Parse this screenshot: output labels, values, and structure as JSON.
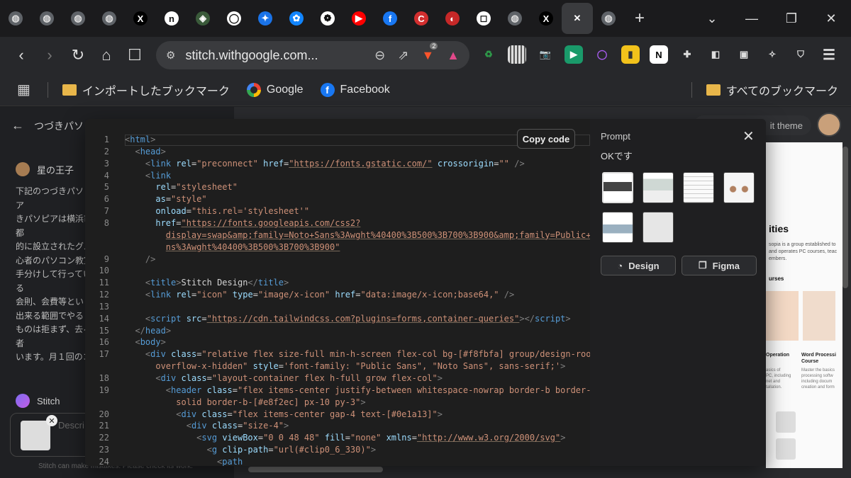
{
  "browser": {
    "tabs": [
      {
        "icon": "globe-icon",
        "color": "#9aa0a6",
        "glyph": "◍"
      },
      {
        "icon": "globe-icon",
        "color": "#9aa0a6",
        "glyph": "◍"
      },
      {
        "icon": "settings-globe-icon",
        "color": "#9aa0a6",
        "glyph": "◍"
      },
      {
        "icon": "settings-globe-icon",
        "color": "#9aa0a6",
        "glyph": "◍"
      },
      {
        "icon": "x-logo-icon",
        "color": "#000000",
        "glyph": "X"
      },
      {
        "icon": "n-logo-icon",
        "color": "#ffffff",
        "glyph": "n"
      },
      {
        "icon": "emblem-icon",
        "color": "#3a5a3a",
        "glyph": "◈"
      },
      {
        "icon": "circle-logo-icon",
        "color": "#ffffff",
        "glyph": "◯"
      },
      {
        "icon": "sparkle-icon",
        "color": "#1a73e8",
        "glyph": "✦"
      },
      {
        "icon": "butterfly-icon",
        "color": "#1185fe",
        "glyph": "✿"
      },
      {
        "icon": "openai-icon",
        "color": "#ffffff",
        "glyph": "❁"
      },
      {
        "icon": "youtube-icon",
        "color": "#ff0000",
        "glyph": "▶"
      },
      {
        "icon": "facebook-icon",
        "color": "#1877f2",
        "glyph": "f"
      },
      {
        "icon": "c-logo-icon",
        "color": "#d32f2f",
        "glyph": "C"
      },
      {
        "icon": "circle-d-icon",
        "color": "#c62828",
        "glyph": "◐"
      },
      {
        "icon": "square-logo-icon",
        "color": "#ffffff",
        "glyph": "◻"
      },
      {
        "icon": "globe-icon",
        "color": "#9aa0a6",
        "glyph": "◍"
      },
      {
        "icon": "x-logo-icon",
        "color": "#000000",
        "glyph": "X"
      },
      {
        "icon": "close-icon",
        "color": "#ffffff",
        "glyph": "✕"
      },
      {
        "icon": "globe-icon",
        "color": "#9aa0a6",
        "glyph": "◍"
      }
    ],
    "url": "stitch.withgoogle.com...",
    "badge_count": "2",
    "bookmarks": [
      {
        "label": "インポートしたブックマーク",
        "icon": "folder-icon"
      },
      {
        "label": "Google",
        "icon": "google-icon"
      },
      {
        "label": "Facebook",
        "icon": "facebook-icon"
      }
    ],
    "all_bookmarks": "すべてのブックマーク"
  },
  "page": {
    "back_title": "つづきパソピア",
    "author": "星の王子",
    "message": "下記のつづきパソピア\nきパソピアは横浜市都\n的に設立されたグル\n心者のパソコン教室\n手分けして行っている\n会則、会費等といっ\n出来る範囲でやるこ\nものは拒まず、去る者\nいます。月１回のコー\nの電縁サロン（IT技\nうれんそう（報告・連\n図っています。また年\nいます。",
    "stitch_label": "Stitch",
    "input_placeholder": "Descri",
    "footer_note": "Stitch can make mistakes. Please check its work.",
    "theme_button": "it theme",
    "preview": {
      "title": "ities",
      "text": "sopia is a group established to\nand operates PC courses, teac\nembers.",
      "section": "urses",
      "card1_label": "Operation",
      "card1_desc": "asics of\nPC, including\nnet and\ntallation.",
      "card2_label": "Word Processi\nCourse",
      "card2_desc": "Master the basics\nprocessing softw\nincluding docum\ncreation and form"
    }
  },
  "modal": {
    "copy_button": "Copy code",
    "side_title": "Prompt",
    "prompt_text": "OKです",
    "design_button": "Design",
    "figma_button": "Figma",
    "code_lines": [
      {
        "n": "1",
        "html": "<span class='punc'>&lt;</span><span class='tag'>html</span><span class='punc'>&gt;</span>"
      },
      {
        "n": "2",
        "html": "  <span class='punc'>&lt;</span><span class='tag'>head</span><span class='punc'>&gt;</span>"
      },
      {
        "n": "3",
        "html": "    <span class='punc'>&lt;</span><span class='tag'>link</span> <span class='attr'>rel</span>=<span class='strp'>\"preconnect\"</span> <span class='attr'>href</span>=<span class='str'>\"https://fonts.gstatic.com/\"</span> <span class='attr'>crossorigin</span>=<span class='strp'>\"\"</span> <span class='punc'>/&gt;</span>"
      },
      {
        "n": "4",
        "html": "    <span class='punc'>&lt;</span><span class='tag'>link</span>"
      },
      {
        "n": "5",
        "html": "      <span class='attr'>rel</span>=<span class='strp'>\"stylesheet\"</span>"
      },
      {
        "n": "6",
        "html": "      <span class='attr'>as</span>=<span class='strp'>\"style\"</span>"
      },
      {
        "n": "7",
        "html": "      <span class='attr'>onload</span>=<span class='strp'>\"this.rel='stylesheet'\"</span>"
      },
      {
        "n": "8",
        "html": "      <span class='attr'>href</span>=<span class='str'>\"https://fonts.googleapis.com/css2?</span>"
      },
      {
        "n": "",
        "html": "        <span class='str'>display=swap&amp;amp;family=Noto+Sans%3Awght%40400%3B500%3B700%3B900&amp;amp;family=Public+Sa</span>"
      },
      {
        "n": "",
        "html": "        <span class='str'>ns%3Awght%40400%3B500%3B700%3B900\"</span>"
      },
      {
        "n": "9",
        "html": "    <span class='punc'>/&gt;</span>"
      },
      {
        "n": "10",
        "html": ""
      },
      {
        "n": "11",
        "html": "    <span class='punc'>&lt;</span><span class='tag'>title</span><span class='punc'>&gt;</span>Stitch Design<span class='punc'>&lt;/</span><span class='tag'>title</span><span class='punc'>&gt;</span>"
      },
      {
        "n": "12",
        "html": "    <span class='punc'>&lt;</span><span class='tag'>link</span> <span class='attr'>rel</span>=<span class='strp'>\"icon\"</span> <span class='attr'>type</span>=<span class='strp'>\"image/x-icon\"</span> <span class='attr'>href</span>=<span class='strp'>\"data:image/x-icon;base64,\"</span> <span class='punc'>/&gt;</span>"
      },
      {
        "n": "13",
        "html": ""
      },
      {
        "n": "14",
        "html": "    <span class='punc'>&lt;</span><span class='tag'>script</span> <span class='attr'>src</span>=<span class='str'>\"https://cdn.tailwindcss.com?plugins=forms,container-queries\"</span><span class='punc'>&gt;&lt;/</span><span class='tag'>script</span><span class='punc'>&gt;</span>"
      },
      {
        "n": "15",
        "html": "  <span class='punc'>&lt;/</span><span class='tag'>head</span><span class='punc'>&gt;</span>"
      },
      {
        "n": "16",
        "html": "  <span class='punc'>&lt;</span><span class='tag'>body</span><span class='punc'>&gt;</span>"
      },
      {
        "n": "17",
        "html": "    <span class='punc'>&lt;</span><span class='tag'>div</span> <span class='attr'>class</span>=<span class='strp'>\"relative flex size-full min-h-screen flex-col bg-[#f8fbfa] group/design-root</span>"
      },
      {
        "n": "",
        "html": "      <span class='strp'>overflow-x-hidden\"</span> <span class='attr'>style</span>=<span class='strp'>'font-family: \"Public Sans\", \"Noto Sans\", sans-serif;'</span><span class='punc'>&gt;</span>"
      },
      {
        "n": "18",
        "html": "      <span class='punc'>&lt;</span><span class='tag'>div</span> <span class='attr'>class</span>=<span class='strp'>\"layout-container flex h-full grow flex-col\"</span><span class='punc'>&gt;</span>"
      },
      {
        "n": "19",
        "html": "        <span class='punc'>&lt;</span><span class='tag'>header</span> <span class='attr'>class</span>=<span class='strp'>\"flex items-center justify-between whitespace-nowrap border-b border-</span>"
      },
      {
        "n": "",
        "html": "          <span class='strp'>solid border-b-[#e8f2ec] px-10 py-3\"</span><span class='punc'>&gt;</span>"
      },
      {
        "n": "20",
        "html": "          <span class='punc'>&lt;</span><span class='tag'>div</span> <span class='attr'>class</span>=<span class='strp'>\"flex items-center gap-4 text-[#0e1a13]\"</span><span class='punc'>&gt;</span>"
      },
      {
        "n": "21",
        "html": "            <span class='punc'>&lt;</span><span class='tag'>div</span> <span class='attr'>class</span>=<span class='strp'>\"size-4\"</span><span class='punc'>&gt;</span>"
      },
      {
        "n": "22",
        "html": "              <span class='punc'>&lt;</span><span class='tag'>svg</span> <span class='attr'>viewBox</span>=<span class='strp'>\"0 0 48 48\"</span> <span class='attr'>fill</span>=<span class='strp'>\"none\"</span> <span class='attr'>xmlns</span>=<span class='str'>\"http://www.w3.org/2000/svg\"</span><span class='punc'>&gt;</span>"
      },
      {
        "n": "23",
        "html": "                <span class='punc'>&lt;</span><span class='tag'>g</span> <span class='attr'>clip-path</span>=<span class='strp'>\"url(#clip0_6_330)\"</span><span class='punc'>&gt;</span>"
      },
      {
        "n": "24",
        "html": "                  <span class='punc'>&lt;</span><span class='tag'>path</span>"
      }
    ]
  }
}
